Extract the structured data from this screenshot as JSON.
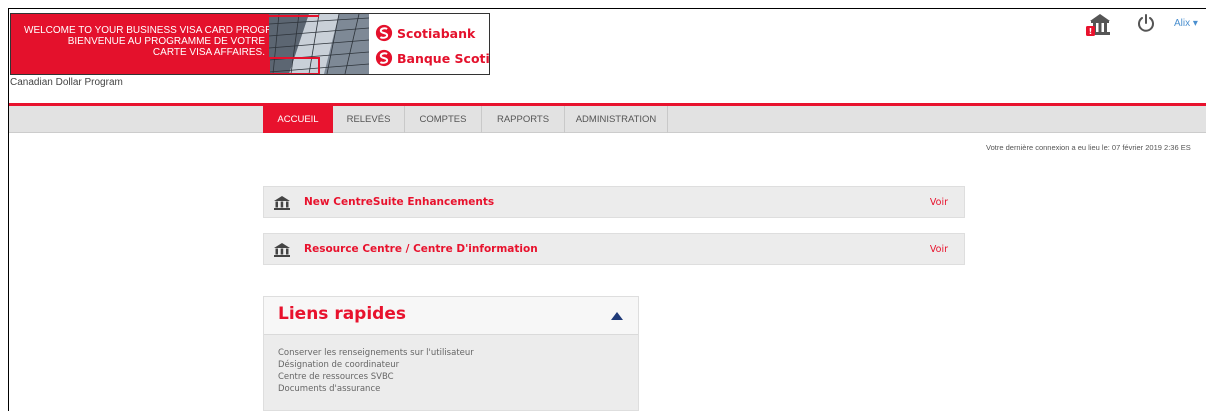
{
  "banner": {
    "line1": "WELCOME TO YOUR BUSINESS VISA CARD PROGRAM.",
    "line2": "BIENVENUE AU PROGRAMME DE VOTRE",
    "line3": "CARTE VISA AFFAIRES.",
    "logo_en": "Scotiabank",
    "logo_fr": "Banque Scotia"
  },
  "program_name": "Canadian Dollar Program",
  "header": {
    "user_label": "Alix ▾",
    "alert_badge": "!"
  },
  "nav": {
    "tabs": [
      {
        "label": "ACCUEIL",
        "active": true
      },
      {
        "label": "RELEVÉS",
        "active": false
      },
      {
        "label": "COMPTES",
        "active": false
      },
      {
        "label": "RAPPORTS",
        "active": false
      },
      {
        "label": "ADMINISTRATION",
        "active": false
      }
    ]
  },
  "last_login": "Votre dernière connexion a eu lieu le: 07 février 2019 2:36 ES",
  "panels": [
    {
      "title": "New CentreSuite Enhancements",
      "action": "Voir"
    },
    {
      "title": "Resource Centre / Centre D'information",
      "action": "Voir"
    }
  ],
  "quick_links": {
    "title": "Liens rapides",
    "items": [
      "Conserver les renseignements sur l'utilisateur",
      "Désignation de coordinateur",
      "Centre de ressources SVBC",
      "Documents d'assurance"
    ]
  },
  "colors": {
    "brand_red": "#e8122d",
    "nav_bg": "#e2e2e2",
    "panel_bg": "#ececec",
    "user_link": "#4a8fcf",
    "arrow": "#1f3a78"
  }
}
